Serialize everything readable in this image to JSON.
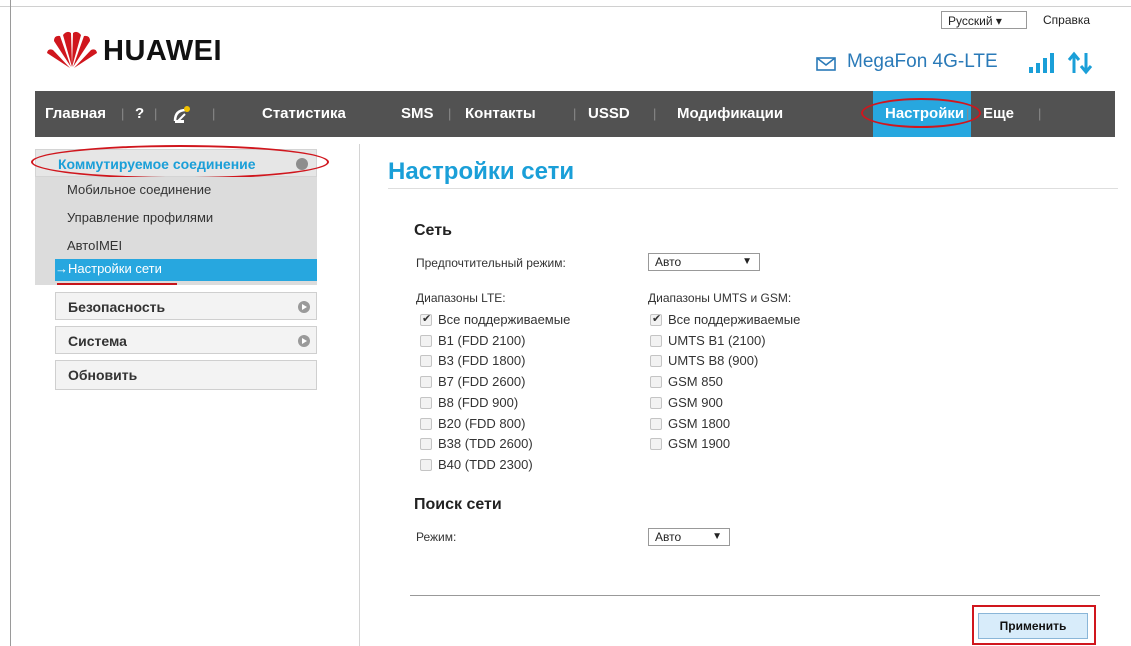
{
  "header": {
    "logo_text": "HUAWEI",
    "language": "Русский",
    "help": "Справка",
    "operator": "MegaFon 4G-LTE",
    "icons": [
      "mail-icon",
      "signal-icon",
      "transfer-icon"
    ],
    "brand_color": "#d0161d"
  },
  "nav": {
    "items": [
      "Главная",
      "?",
      "Статистика",
      "SMS",
      "Контакты",
      "USSD",
      "Модификации",
      "Настройки",
      "Еще"
    ],
    "active": "Настройки",
    "active_color": "#27a7df",
    "bar_color": "#525252"
  },
  "sidebar": {
    "dial_group": "Коммутируемое соединение",
    "dial_items": [
      "Мобильное соединение",
      "Управление профилями",
      "AвтоIMEI"
    ],
    "active_item": "→Настройки сети",
    "groups": [
      "Безопасность",
      "Система",
      "Обновить"
    ]
  },
  "main": {
    "title": "Настройки сети",
    "section_network": "Сеть",
    "preferred_mode_label": "Предпочтительный режим:",
    "preferred_mode_value": "Авто",
    "lte_title": "Диапазоны LTE:",
    "lte_bands": [
      {
        "label": "Все поддерживаемые",
        "checked": true
      },
      {
        "label": "B1 (FDD 2100)",
        "checked": false
      },
      {
        "label": "B3 (FDD 1800)",
        "checked": false
      },
      {
        "label": "B7 (FDD 2600)",
        "checked": false
      },
      {
        "label": "B8 (FDD 900)",
        "checked": false
      },
      {
        "label": "B20 (FDD 800)",
        "checked": false
      },
      {
        "label": "B38 (TDD 2600)",
        "checked": false
      },
      {
        "label": "B40 (TDD 2300)",
        "checked": false
      }
    ],
    "umts_title": "Диапазоны UMTS и GSM:",
    "umts_bands": [
      {
        "label": "Все поддерживаемые",
        "checked": true
      },
      {
        "label": "UMTS B1 (2100)",
        "checked": false
      },
      {
        "label": "UMTS B8 (900)",
        "checked": false
      },
      {
        "label": "GSM 850",
        "checked": false
      },
      {
        "label": "GSM 900",
        "checked": false
      },
      {
        "label": "GSM 1800",
        "checked": false
      },
      {
        "label": "GSM 1900",
        "checked": false
      }
    ],
    "section_search": "Поиск сети",
    "search_mode_label": "Режим:",
    "search_mode_value": "Авто",
    "apply_label": "Применить"
  }
}
